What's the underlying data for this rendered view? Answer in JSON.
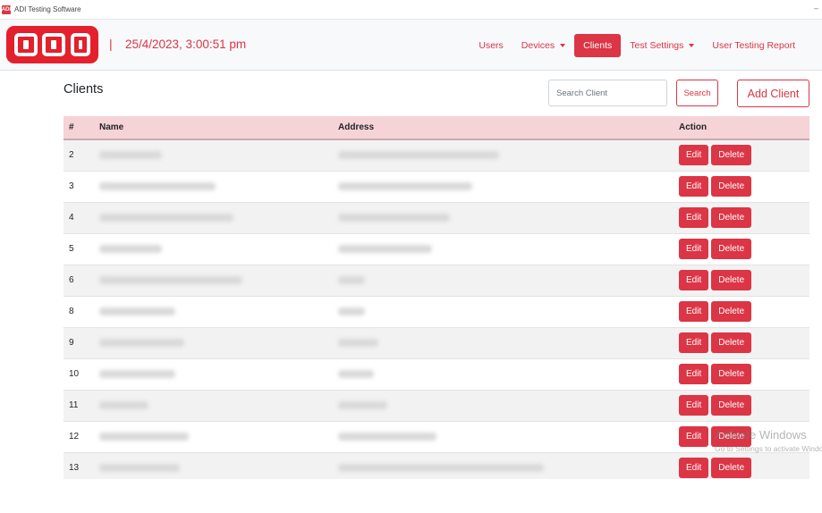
{
  "window": {
    "title": "ADI Testing Software",
    "icon": "adi-app-icon",
    "minimize": "–"
  },
  "navbar": {
    "logo": "ADI",
    "separator": "|",
    "datetime": "25/4/2023, 3:00:51 pm",
    "links": [
      {
        "label": "Users",
        "active": false,
        "dropdown": false
      },
      {
        "label": "Devices",
        "active": false,
        "dropdown": true
      },
      {
        "label": "Clients",
        "active": true,
        "dropdown": false
      },
      {
        "label": "Test Settings",
        "active": false,
        "dropdown": true
      },
      {
        "label": "User Testing Report",
        "active": false,
        "dropdown": false
      }
    ]
  },
  "main": {
    "title": "Clients",
    "search": {
      "placeholder": "Search Client",
      "value": "",
      "button_label": "Search"
    },
    "add_button_label": "Add Client"
  },
  "table": {
    "columns": [
      "#",
      "Name",
      "Address",
      "Action"
    ],
    "rows": [
      {
        "id": "2",
        "name": "",
        "address": ""
      },
      {
        "id": "3",
        "name": "",
        "address": ""
      },
      {
        "id": "4",
        "name": "",
        "address": ""
      },
      {
        "id": "5",
        "name": "",
        "address": ""
      },
      {
        "id": "6",
        "name": "",
        "address": ""
      },
      {
        "id": "8",
        "name": "",
        "address": ""
      },
      {
        "id": "9",
        "name": "",
        "address": ""
      },
      {
        "id": "10",
        "name": "",
        "address": ""
      },
      {
        "id": "11",
        "name": "",
        "address": ""
      },
      {
        "id": "12",
        "name": "",
        "address": ""
      },
      {
        "id": "13",
        "name": "",
        "address": ""
      }
    ],
    "edit_label": "Edit",
    "delete_label": "Delete"
  },
  "watermark": {
    "line1": "Activate Windows",
    "line2": "Go to Settings to activate Windows."
  },
  "colors": {
    "accent": "#dc3545",
    "logo": "#e3202c",
    "header_row": "#f6d3d6",
    "navbar_bg": "#f8f9fa"
  }
}
